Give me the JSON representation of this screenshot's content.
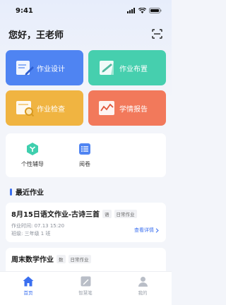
{
  "status_bar": {
    "time": "9:41"
  },
  "header": {
    "greeting": "您好，王老师"
  },
  "tiles": [
    {
      "label": "作业设计",
      "color": "#4f84f2"
    },
    {
      "label": "作业布置",
      "color": "#46cfae"
    },
    {
      "label": "作业检查",
      "color": "#f0b441"
    },
    {
      "label": "学情报告",
      "color": "#f2795b"
    }
  ],
  "quick_actions": [
    {
      "label": "个性辅导",
      "icon": "tutoring-icon"
    },
    {
      "label": "阅卷",
      "icon": "grading-icon"
    }
  ],
  "recent": {
    "title": "最近作业",
    "items": [
      {
        "title": "8月15日语文作业-古诗三首",
        "subject": "语",
        "type": "日常作业",
        "time": "作业时间: 07.13 15:20",
        "class": "班级: 三年级 1 班",
        "link": "查看详情"
      },
      {
        "title": "周末数学作业",
        "subject": "数",
        "type": "日常作业"
      }
    ]
  },
  "tabbar": {
    "items": [
      {
        "label": "首页",
        "active": true
      },
      {
        "label": "智慧笔",
        "active": false
      },
      {
        "label": "我的",
        "active": false
      }
    ]
  }
}
